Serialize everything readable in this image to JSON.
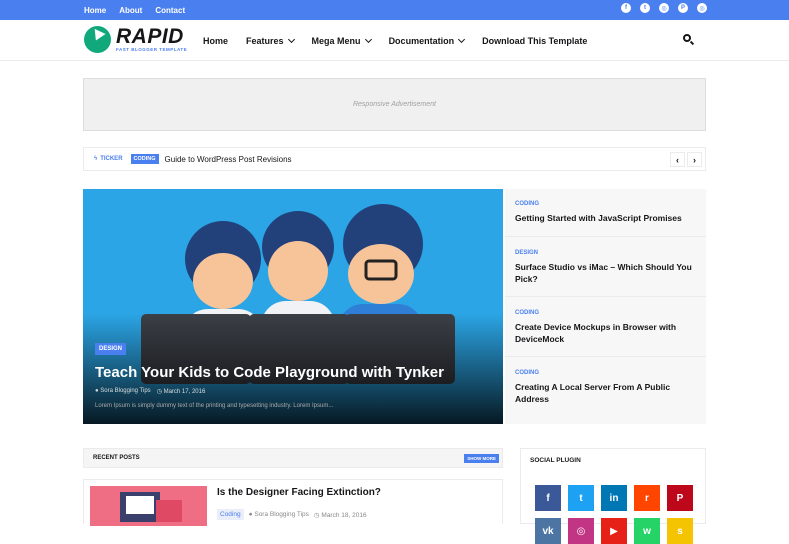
{
  "topbar": {
    "links": [
      "Home",
      "About",
      "Contact"
    ],
    "social": [
      "facebook-icon",
      "twitter-icon",
      "instagram-icon",
      "pinterest-icon",
      "instagram-icon"
    ]
  },
  "header": {
    "logo_title": "RAPID",
    "logo_subtitle": "FAST BLOGGER TEMPLATE",
    "nav": [
      {
        "label": "Home",
        "dropdown": false
      },
      {
        "label": "Features",
        "dropdown": true
      },
      {
        "label": "Mega Menu",
        "dropdown": true
      },
      {
        "label": "Documentation",
        "dropdown": true
      },
      {
        "label": "Download This Template",
        "dropdown": false
      }
    ]
  },
  "ad": {
    "text": "Responsive Advertisement"
  },
  "ticker": {
    "label": "TICKER",
    "badge": "CODING",
    "text": "Guide to WordPress Post Revisions",
    "prev": "‹",
    "next": "›"
  },
  "featured": {
    "badge": "DESIGN",
    "title": "Teach Your Kids to Code Playground with Tynker",
    "author": "Sora Blogging Tips",
    "date": "March 17, 2016",
    "excerpt": "Lorem Ipsum is simply dummy text of the printing and typesetting industry. Lorem Ipsum..."
  },
  "side_posts": [
    {
      "category": "CODING",
      "title": "Getting Started with JavaScript Promises"
    },
    {
      "category": "DESIGN",
      "title": "Surface Studio vs iMac – Which Should You Pick?"
    },
    {
      "category": "CODING",
      "title": "Create Device Mockups in Browser with DeviceMock"
    },
    {
      "category": "CODING",
      "title": "Creating A Local Server From A Public Address"
    }
  ],
  "recent": {
    "heading": "RECENT POSTS",
    "show_more": "SHOW MORE",
    "posts": [
      {
        "title": "Is the Designer Facing Extinction?",
        "tag": "Coding",
        "author": "Sora Blogging Tips",
        "date": "March 18, 2016"
      }
    ]
  },
  "social_plugin": {
    "heading": "SOCIAL PLUGIN",
    "icons": [
      {
        "name": "facebook-icon",
        "glyph": "f",
        "color": "#3b5998"
      },
      {
        "name": "twitter-icon",
        "glyph": "t",
        "color": "#1da1f2"
      },
      {
        "name": "linkedin-icon",
        "glyph": "in",
        "color": "#0077b5"
      },
      {
        "name": "reddit-icon",
        "glyph": "r",
        "color": "#ff4500"
      },
      {
        "name": "pinterest-icon",
        "glyph": "P",
        "color": "#bd081c"
      },
      {
        "name": "vk-icon",
        "glyph": "vk",
        "color": "#4c75a3"
      },
      {
        "name": "instagram-icon",
        "glyph": "◎",
        "color": "#c13584"
      },
      {
        "name": "youtube-icon",
        "glyph": "▶",
        "color": "#e62117"
      },
      {
        "name": "whatsapp-icon",
        "glyph": "w",
        "color": "#25d366"
      },
      {
        "name": "snapchat-icon",
        "glyph": "s",
        "color": "#f4c402"
      }
    ]
  },
  "colors": {
    "accent": "#4a7ff0",
    "logo": "#11a97c",
    "hero_bg": "#2ba5e5"
  }
}
